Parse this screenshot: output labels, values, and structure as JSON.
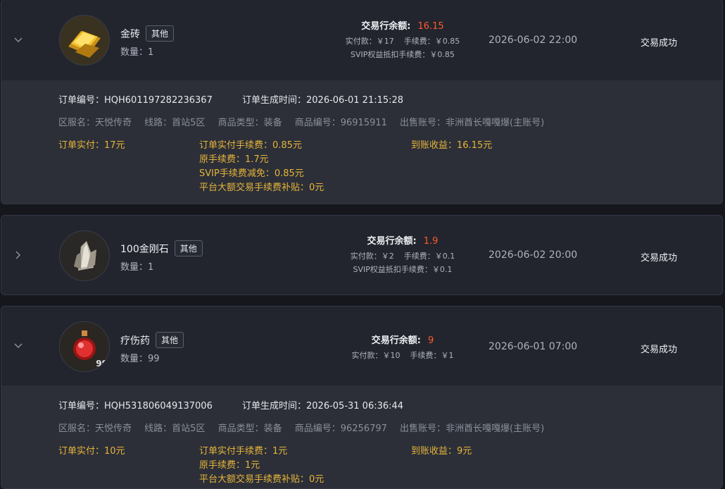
{
  "orders": [
    {
      "item_name": "金砖",
      "tag": "其他",
      "quantity_label": "数量：1",
      "balance_label": "交易行余额:",
      "balance_value": "16.15",
      "pay_line": "实付款：￥17",
      "fee_line": "手续费：￥0.85",
      "svip_line": "SVIP权益抵扣手续费：￥0.85",
      "time": "2026-06-02 22:00",
      "status": "交易成功",
      "chevron": "chevron-down-icon",
      "detail": {
        "order_no": "订单编号：HQH601197282236367",
        "created": "订单生成时间：2026-06-01 21:15:28",
        "server": "区服名：天悦传奇",
        "line": "线路：首站5区",
        "type": "商品类型：装备",
        "goods_no": "商品编号：96915911",
        "seller": "出售账号：非洲酋长嘎嘎爆(主账号)",
        "paid": "订单实付：17元",
        "fee_paid": "订单实付手续费：0.85元",
        "orig_fee": "原手续费：1.7元",
        "svip_reduce": "SVIP手续费减免：0.85元",
        "subsidy": "平台大额交易手续费补贴：0元",
        "income": "到账收益：16.15元"
      }
    },
    {
      "item_name": "100金刚石",
      "tag": "其他",
      "quantity_label": "数量：1",
      "balance_label": "交易行余额:",
      "balance_value": "1.9",
      "pay_line": "实付款：￥2",
      "fee_line": "手续费：￥0.1",
      "svip_line": "SVIP权益抵扣手续费：￥0.1",
      "time": "2026-06-02 20:00",
      "status": "交易成功",
      "chevron": "chevron-right-icon"
    },
    {
      "item_name": "疗伤药",
      "tag": "其他",
      "quantity_label": "数量：99",
      "balance_label": "交易行余额:",
      "balance_value": "9",
      "pay_line": "实付款：￥10",
      "fee_line": "手续费：￥1",
      "thumb_badge": "99",
      "time": "2026-06-01 07:00",
      "status": "交易成功",
      "chevron": "chevron-down-icon",
      "detail": {
        "order_no": "订单编号：HQH531806049137006",
        "created": "订单生成时间：2026-05-31 06:36:44",
        "server": "区服名：天悦传奇",
        "line": "线路：首站5区",
        "type": "商品类型：装备",
        "goods_no": "商品编号：96256797",
        "seller": "出售账号：非洲酋长嘎嘎爆(主账号)",
        "paid": "订单实付：10元",
        "fee_paid": "订单实付手续费：1元",
        "orig_fee": "原手续费：1元",
        "subsidy": "平台大额交易手续费补贴：0元",
        "income": "到账收益：9元"
      }
    }
  ],
  "colors": {
    "accent_red": "#ff5a2a",
    "detail_yellow": "#e6b43a",
    "card_bg": "#22252e",
    "detail_bg": "#2c2f38"
  }
}
